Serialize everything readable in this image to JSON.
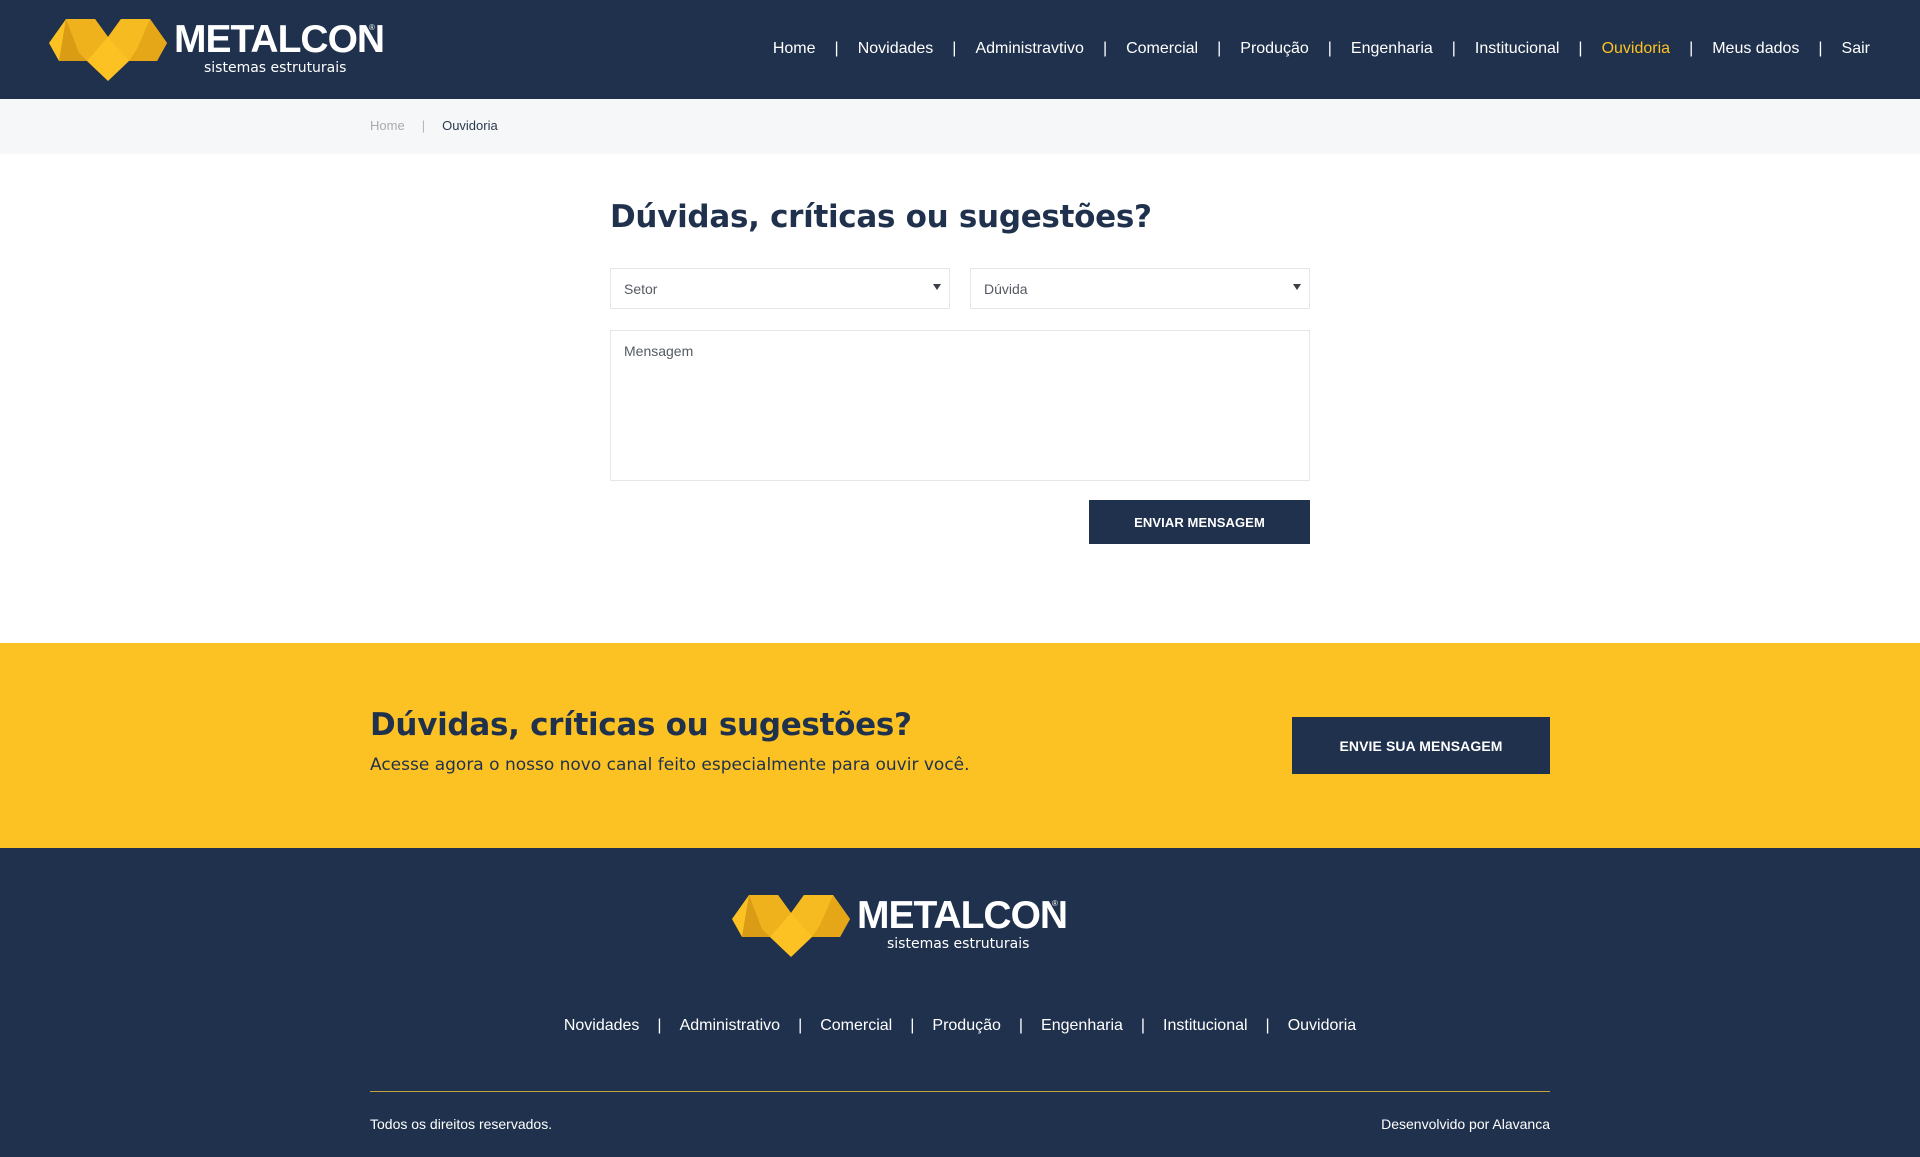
{
  "brand": {
    "name": "METALCON",
    "registered_mark": "®",
    "tagline": "sistemas estruturais",
    "colors": {
      "navy": "#1f314c",
      "yellow": "#fcc223",
      "yellow_dark": "#e0a61a"
    }
  },
  "header": {
    "nav": [
      {
        "label": "Home",
        "active": false
      },
      {
        "label": "Novidades",
        "active": false
      },
      {
        "label": "Administravtivo",
        "active": false
      },
      {
        "label": "Comercial",
        "active": false
      },
      {
        "label": "Produção",
        "active": false
      },
      {
        "label": "Engenharia",
        "active": false
      },
      {
        "label": "Institucional",
        "active": false
      },
      {
        "label": "Ouvidoria",
        "active": true
      },
      {
        "label": "Meus dados",
        "active": false
      },
      {
        "label": "Sair",
        "active": false
      }
    ],
    "separator": "|"
  },
  "breadcrumb": {
    "home": "Home",
    "separator": "|",
    "current": "Ouvidoria"
  },
  "form": {
    "title": "Dúvidas, críticas ou sugestões?",
    "sector_select": {
      "value": "Setor",
      "icon": "caret-down-icon"
    },
    "type_select": {
      "value": "Dúvida",
      "icon": "caret-down-icon"
    },
    "message_placeholder": "Mensagem",
    "submit_label": "ENVIAR MENSAGEM"
  },
  "cta": {
    "title": "Dúvidas, críticas ou sugestões?",
    "subtitle": "Acesse agora o nosso novo canal feito especialmente para ouvir você.",
    "button_label": "ENVIE SUA MENSAGEM"
  },
  "footer": {
    "nav": [
      "Novidades",
      "Administrativo",
      "Comercial",
      "Produção",
      "Engenharia",
      "Institucional",
      "Ouvidoria"
    ],
    "separator": "|",
    "copyright": "Todos os direitos reservados.",
    "credit": "Desenvolvido por Alavanca"
  }
}
